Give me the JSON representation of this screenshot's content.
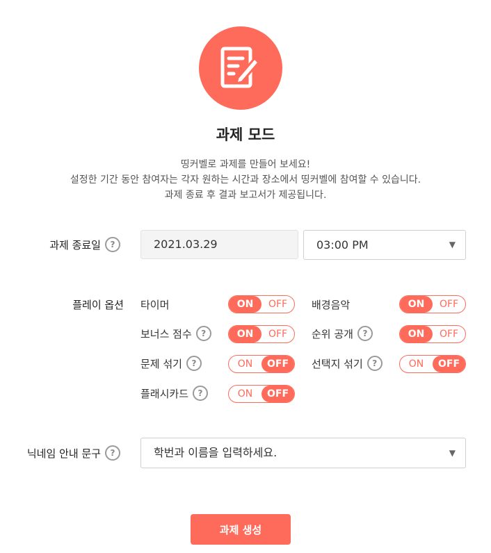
{
  "header": {
    "icon": "edit-document-icon",
    "title": "과제 모드",
    "desc_lines": [
      "띵커벨로 과제를 만들어 보세요!",
      "설정한 기간 동안 참여자는 각자 원하는 시간과 장소에서 띵커벨에 참여할 수 있습니다.",
      "과제 종료 후 결과 보고서가 제공됩니다."
    ]
  },
  "end_date": {
    "label": "과제 종료일",
    "help": "?",
    "date": "2021.03.29",
    "time": "03:00 PM"
  },
  "play_options": {
    "label": "플레이 옵션",
    "on_label": "ON",
    "off_label": "OFF",
    "items": [
      {
        "label": "타이머",
        "help": "",
        "state": "ON"
      },
      {
        "label": "배경음악",
        "help": "",
        "state": "ON"
      },
      {
        "label": "보너스 점수",
        "help": "?",
        "state": "ON"
      },
      {
        "label": "순위 공개",
        "help": "?",
        "state": "ON"
      },
      {
        "label": "문제 섞기",
        "help": "?",
        "state": "OFF"
      },
      {
        "label": "선택지 섞기",
        "help": "?",
        "state": "OFF"
      },
      {
        "label": "플래시카드",
        "help": "?",
        "state": "OFF"
      }
    ]
  },
  "nickname": {
    "label": "닉네임 안내 문구",
    "help": "?",
    "value": "학번과 이름을 입력하세요."
  },
  "dropdown_arrow": "▼",
  "create_button": "과제 생성",
  "colors": {
    "accent": "#ff6b5a"
  }
}
